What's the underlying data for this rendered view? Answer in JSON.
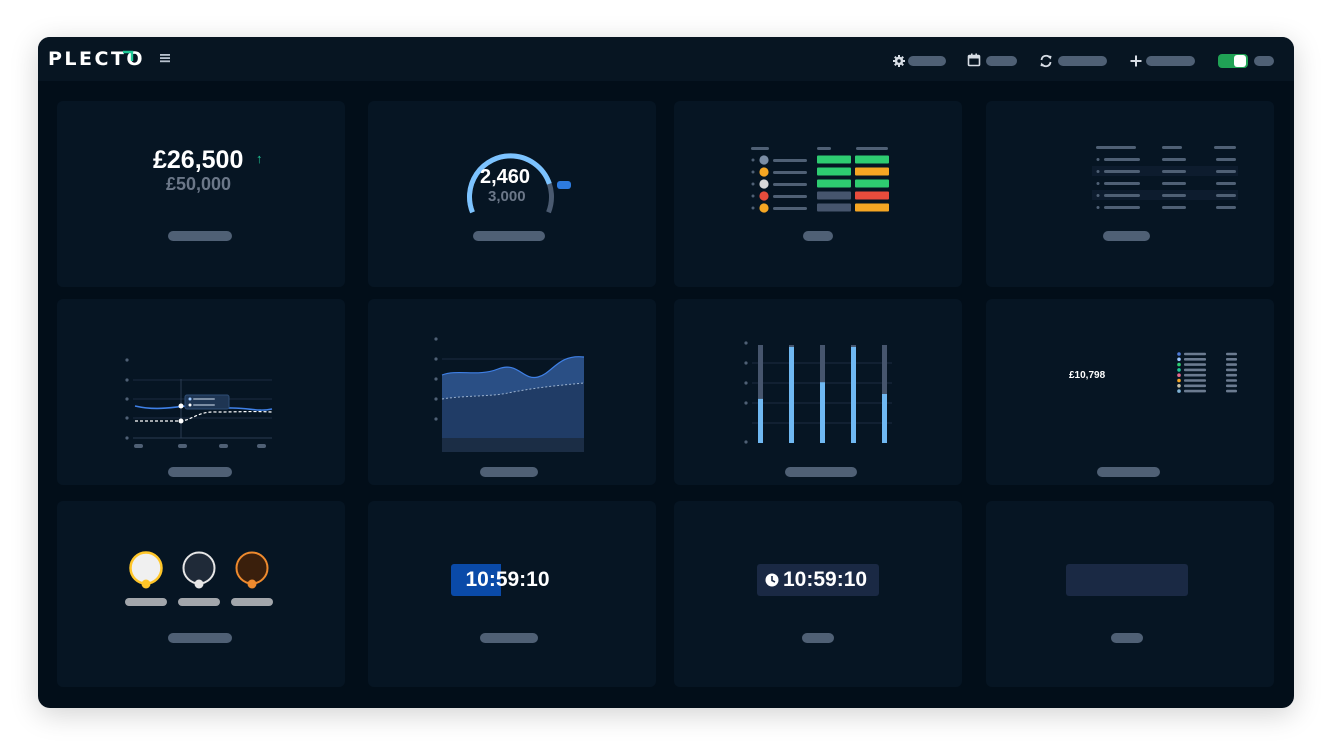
{
  "brand": {
    "logo_text": "PLECTO",
    "accent_color": "#20c997"
  },
  "topbar": {
    "icons": [
      "gear-icon",
      "calendar-icon",
      "refresh-icon",
      "plus-icon",
      "menu-icon"
    ],
    "toggle_on": true,
    "toggle_color": "#20a255"
  },
  "widgets": {
    "number": {
      "value": "£26,500",
      "target": "£50,000",
      "trend": "↑",
      "trend_color": "#20c997"
    },
    "gauge": {
      "value": "2,460",
      "target": "3,000",
      "progress": 0.82
    },
    "table_colors": {
      "green": "#2ecc71",
      "orange": "#f5a623",
      "red": "#e74c3c",
      "gray": "#46556d"
    },
    "bar_levels": [
      0.45,
      0.98,
      0.62,
      0.98,
      0.5
    ],
    "legend_value": "£10,798",
    "legend_dot_colors": [
      "#4e7bd9",
      "#9bc7ff",
      "#2ecc71",
      "#20c997",
      "#e56b8e",
      "#f5a623",
      "#c7c1a8",
      "#7fb3d5"
    ],
    "medals": [
      "gold",
      "silver",
      "bronze"
    ],
    "timer_1": "10:59:10",
    "timer_2": "10:59:10"
  }
}
